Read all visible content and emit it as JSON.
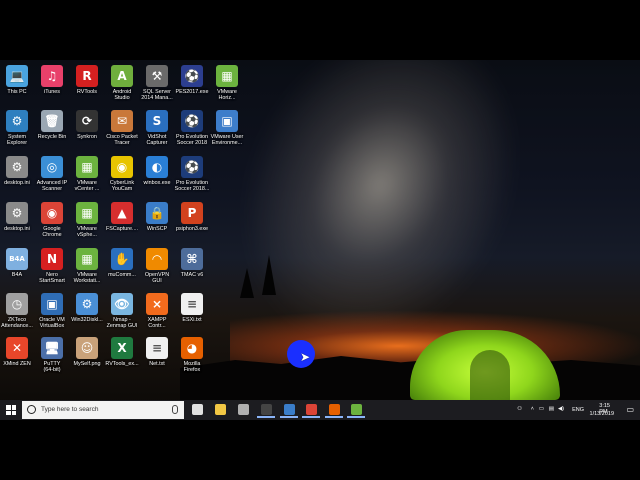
{
  "desktop": {
    "icons": [
      {
        "label": "This PC",
        "icon": "this-pc-icon",
        "color": "#4aa3df",
        "glyph": "💻"
      },
      {
        "label": "iTunes",
        "icon": "itunes-icon",
        "color": "#e8406a",
        "glyph": "♫"
      },
      {
        "label": "RVTools",
        "icon": "rvtools-icon",
        "color": "#d42020",
        "glyph": "R"
      },
      {
        "label": "Android\nStudio",
        "icon": "android-studio-icon",
        "color": "#6fae3d",
        "glyph": "A"
      },
      {
        "label": "SQL Server\n2014 Mana...",
        "icon": "sql-server-icon",
        "color": "#6a6a6a",
        "glyph": "⚒"
      },
      {
        "label": "PES2017.exe",
        "icon": "pes2017-icon",
        "color": "#2c3e90",
        "glyph": "⚽"
      },
      {
        "label": "VMware\nHoriz...",
        "icon": "vmware-horizon-icon",
        "color": "#6cb33f",
        "glyph": "▦"
      },
      {
        "label": "System\nExplorer",
        "icon": "system-explorer-icon",
        "color": "#2e7fbf",
        "glyph": "⚙"
      },
      {
        "label": "Recycle Bin",
        "icon": "recycle-bin-icon",
        "color": "#9aa7b3",
        "glyph": "🗑"
      },
      {
        "label": "Synkron",
        "icon": "synkron-icon",
        "color": "#333333",
        "glyph": "⟳"
      },
      {
        "label": "Cisco Packet\nTracer",
        "icon": "cisco-packet-tracer-icon",
        "color": "#c9783a",
        "glyph": "✉"
      },
      {
        "label": "VidShot\nCapturer",
        "icon": "vidshot-icon",
        "color": "#2a6fbf",
        "glyph": "S"
      },
      {
        "label": "Pro Evolution\nSoccer 2018",
        "icon": "pes2018-icon",
        "color": "#1d3c7a",
        "glyph": "⚽"
      },
      {
        "label": "VMware User\nEnvironme...",
        "icon": "vmware-user-env-icon",
        "color": "#3d7dca",
        "glyph": "▣"
      },
      {
        "label": "desktop.ini",
        "icon": "desktop-ini-icon",
        "color": "#8a8a8a",
        "glyph": "⚙"
      },
      {
        "label": "Advanced IP\nScanner",
        "icon": "advanced-ip-scanner-icon",
        "color": "#3b8fd6",
        "glyph": "◎"
      },
      {
        "label": "VMware\nvCenter ...",
        "icon": "vmware-vcenter-icon",
        "color": "#6cb33f",
        "glyph": "▦"
      },
      {
        "label": "CyberLink\nYouCam",
        "icon": "cyberlink-youcam-icon",
        "color": "#e8c400",
        "glyph": "◉"
      },
      {
        "label": "winbox.exe",
        "icon": "winbox-icon",
        "color": "#2a7fd6",
        "glyph": "◐"
      },
      {
        "label": "Pro Evolution\nSoccer 2018...",
        "icon": "pes2018-launcher-icon",
        "color": "#1d3c7a",
        "glyph": "⚽"
      },
      {
        "label": "desktop.ini",
        "icon": "desktop-ini-icon",
        "color": "#8a8a8a",
        "glyph": "⚙"
      },
      {
        "label": "Google\nChrome",
        "icon": "chrome-icon",
        "color": "#db4437",
        "glyph": "◉"
      },
      {
        "label": "VMware\nvSphe...",
        "icon": "vmware-vsphere-icon",
        "color": "#6cb33f",
        "glyph": "▦"
      },
      {
        "label": "FSCapture....",
        "icon": "fscapture-icon",
        "color": "#d62e2e",
        "glyph": "▲"
      },
      {
        "label": "WinSCP",
        "icon": "winscp-icon",
        "color": "#3a7dc9",
        "glyph": "🔒"
      },
      {
        "label": "psiphon3.exe",
        "icon": "psiphon-icon",
        "color": "#d2421e",
        "glyph": "P"
      },
      {
        "label": "B4A",
        "icon": "b4a-icon",
        "color": "#7fb0e0",
        "glyph": "B4A"
      },
      {
        "label": "Nero\nStartSmart",
        "icon": "nero-icon",
        "color": "#d62020",
        "glyph": "N"
      },
      {
        "label": "VMware\nWorkstati...",
        "icon": "vmware-workstation-icon",
        "color": "#6cb33f",
        "glyph": "▦"
      },
      {
        "label": "muComm...",
        "icon": "mucommander-icon",
        "color": "#2a6fbf",
        "glyph": "✋"
      },
      {
        "label": "OpenVPN\nGUI",
        "icon": "openvpn-icon",
        "color": "#f08a00",
        "glyph": "◠"
      },
      {
        "label": "TMAC v6",
        "icon": "tmac-icon",
        "color": "#4d6c9a",
        "glyph": "⌘"
      },
      {
        "label": "ZKTeco\nAttendance...",
        "icon": "zkteco-icon",
        "color": "#a0a0a0",
        "glyph": "◷"
      },
      {
        "label": "Oracle VM\nVirtualBox",
        "icon": "virtualbox-icon",
        "color": "#2f6db5",
        "glyph": "▣"
      },
      {
        "label": "Win32Diskl...",
        "icon": "win32diskimager-icon",
        "color": "#4a8fd6",
        "glyph": "⚙"
      },
      {
        "label": "Nmap -\nZenmap GUI",
        "icon": "zenmap-icon",
        "color": "#7ab6e0",
        "glyph": "👁"
      },
      {
        "label": "XAMPP\nContr...",
        "icon": "xampp-icon",
        "color": "#f26b1d",
        "glyph": "⨯"
      },
      {
        "label": "ESXi.txt",
        "icon": "text-file-icon",
        "color": "#f0f0f0",
        "glyph": "≡"
      },
      {
        "label": "XMind ZEN",
        "icon": "xmind-icon",
        "color": "#e8462a",
        "glyph": "✕"
      },
      {
        "label": "PuTTY\n(64-bit)",
        "icon": "putty-icon",
        "color": "#4b6fa8",
        "glyph": "🖥"
      },
      {
        "label": "MySelf.png",
        "icon": "image-file-icon",
        "color": "#c9a27a",
        "glyph": "☺"
      },
      {
        "label": "RVTools_ex...",
        "icon": "excel-file-icon",
        "color": "#1f7a3f",
        "glyph": "X"
      },
      {
        "label": "Net.txt",
        "icon": "text-file-icon",
        "color": "#f0f0f0",
        "glyph": "≡"
      },
      {
        "label": "Mozilla\nFirefox",
        "icon": "firefox-icon",
        "color": "#e66000",
        "glyph": "◕"
      }
    ]
  },
  "taskbar": {
    "search_placeholder": "Type here to search",
    "pinned": [
      {
        "icon": "task-view-icon",
        "color": "#e0e0e0"
      },
      {
        "icon": "file-explorer-icon",
        "color": "#f2c744"
      },
      {
        "icon": "network-tool-icon",
        "color": "#b0b0b0"
      },
      {
        "icon": "terminal-icon",
        "color": "#444444"
      },
      {
        "icon": "remote-desktop-icon",
        "color": "#3a7dc9"
      },
      {
        "icon": "chrome-icon",
        "color": "#db4437"
      },
      {
        "icon": "firefox-icon",
        "color": "#e66000"
      },
      {
        "icon": "vmware-icon",
        "color": "#6cb33f"
      }
    ],
    "tray": {
      "language": "ENG",
      "time": "3:15 PM",
      "date": "1/13/2019"
    }
  }
}
